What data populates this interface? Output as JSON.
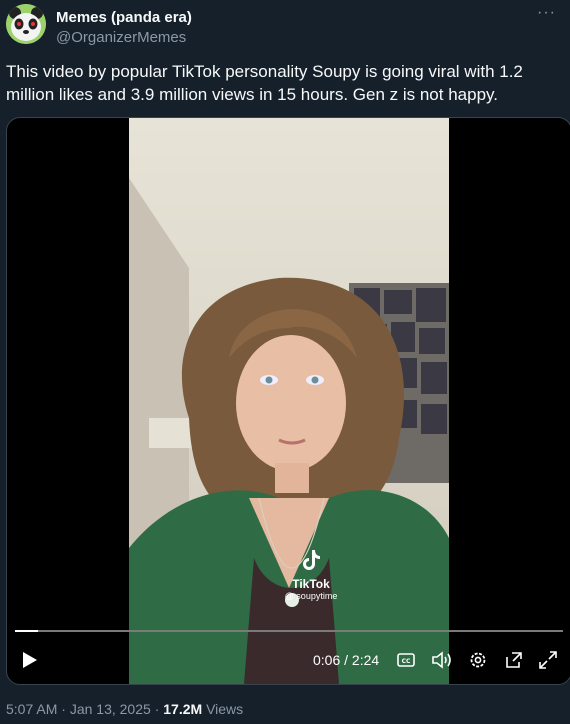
{
  "author": {
    "name": "Memes (panda era)",
    "handle": "@OrganizerMemes",
    "avatar_icon": "panda-avatar-icon",
    "more_label": "···"
  },
  "tweet": {
    "text": "This video by popular TikTok personality Soupy is going viral with 1.2 million likes and 3.9 million views in 15 hours. Gen z is not happy."
  },
  "video": {
    "watermark_brand": "TikTok",
    "watermark_user": "@ soupytime",
    "current_time": "0:06",
    "separator": "/",
    "duration": "2:24",
    "progress_fraction": 0.042,
    "controls": {
      "play_icon": "play-icon",
      "captions_icon": "captions-icon",
      "volume_icon": "volume-icon",
      "settings_icon": "settings-icon",
      "popout_icon": "popout-icon",
      "fullscreen_icon": "fullscreen-icon"
    }
  },
  "meta": {
    "time": "5:07 AM",
    "dot": "·",
    "date": "Jan 13, 2025",
    "views_count": "17.2M",
    "views_label": "Views"
  },
  "colors": {
    "background": "#15202b",
    "text": "#f7f9f9",
    "muted": "#8b98a5",
    "cardigan": "#2f6b45"
  }
}
